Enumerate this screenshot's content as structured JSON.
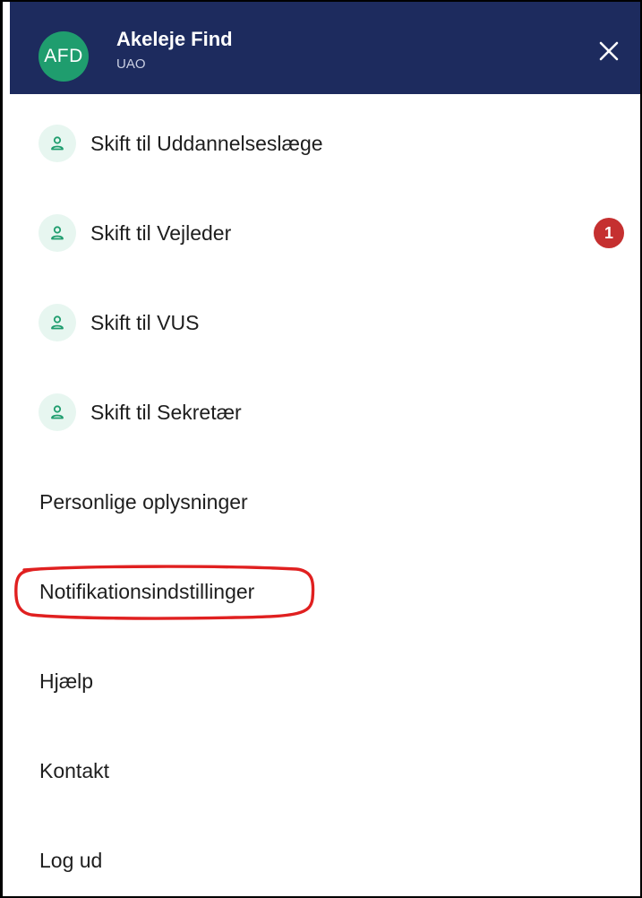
{
  "header": {
    "avatar_initials": "AFD",
    "user_name": "Akeleje Find",
    "user_role": "UAO",
    "close_icon": "close-icon",
    "background_color": "#1d2b5e",
    "avatar_color": "#1f9d6e"
  },
  "menu": {
    "role_items": [
      {
        "label": "Skift til Uddannelseslæge",
        "icon": "user-icon"
      },
      {
        "label": "Skift til Vejleder",
        "icon": "user-icon",
        "badge": "1"
      },
      {
        "label": "Skift til VUS",
        "icon": "user-icon"
      },
      {
        "label": "Skift til Sekretær",
        "icon": "user-icon"
      }
    ],
    "links": [
      {
        "label": "Personlige oplysninger"
      },
      {
        "label": "Notifikationsindstillinger",
        "highlighted": true
      },
      {
        "label": "Hjælp"
      },
      {
        "label": "Kontakt"
      },
      {
        "label": "Log ud"
      }
    ],
    "badge_color": "#c53030",
    "highlight_color": "#e02020"
  }
}
